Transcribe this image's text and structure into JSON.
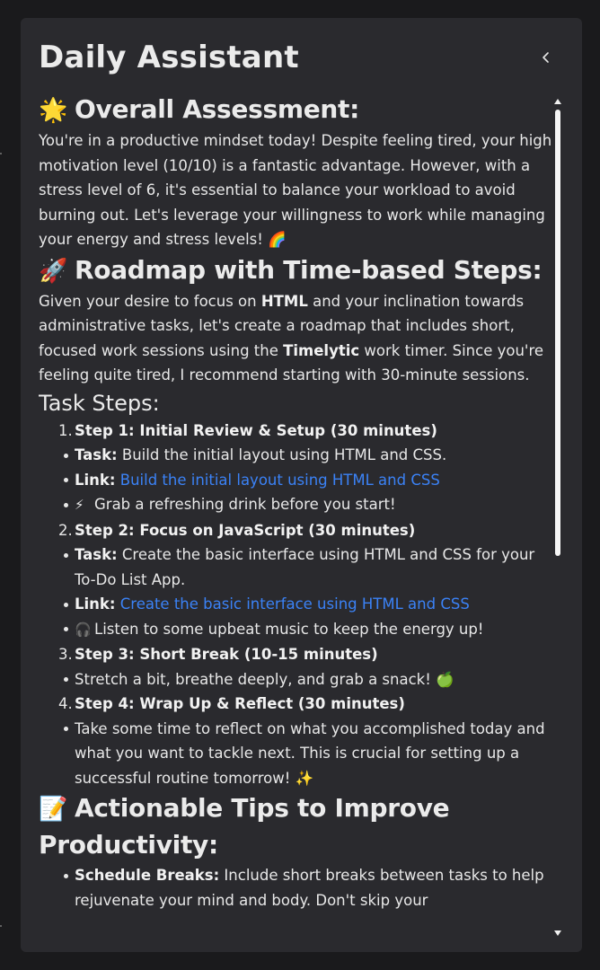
{
  "panel": {
    "title": "Daily Assistant",
    "collapse_icon": "chevron-left-icon"
  },
  "assessment": {
    "emoji": "🌟",
    "heading": "Overall Assessment:",
    "text": "You're in a productive mindset today! Despite feeling tired, your high motivation level (10/10) is a fantastic advantage. However, with a stress level of 6, it's essential to balance your workload to avoid burning out. Let's leverage your willingness to work while managing your energy and stress levels! 🌈"
  },
  "roadmap": {
    "emoji": "🚀",
    "heading": "Roadmap with Time-based Steps:",
    "intro_1": "Given your desire to focus on ",
    "intro_bold_1": "HTML",
    "intro_2": " and your inclination towards administrative tasks, let's create a roadmap that includes short, focused work sessions using the ",
    "intro_bold_2": "Timelytic",
    "intro_3": " work timer. Since you're feeling quite tired, I recommend starting with 30-minute sessions."
  },
  "task_steps": {
    "heading": "Task Steps:",
    "steps": [
      {
        "number": "1.",
        "title": "Step 1: Initial Review & Setup (30 minutes)",
        "task_label": "Task:",
        "task_text": " Build the initial layout using HTML and CSS.",
        "link_label": "Link:",
        "link_text": "Build the initial layout using HTML and CSS",
        "tip_icon": "⚡",
        "tip_text": "Grab a refreshing drink before you start!"
      },
      {
        "number": "2.",
        "title": "Step 2: Focus on JavaScript (30 minutes)",
        "task_label": "Task:",
        "task_text": " Create the basic interface using HTML and CSS for your To-Do List App.",
        "link_label": "Link:",
        "link_text": "Create the basic interface using HTML and CSS",
        "tip_icon": "🎧",
        "tip_text": "Listen to some upbeat music to keep the energy up!"
      },
      {
        "number": "3.",
        "title": "Step 3: Short Break (10-15 minutes)",
        "note": "Stretch a bit, breathe deeply, and grab a snack! 🍏"
      },
      {
        "number": "4.",
        "title": "Step 4: Wrap Up & Reflect (30 minutes)",
        "note": "Take some time to reflect on what you accomplished today and what you want to tackle next. This is crucial for setting up a successful routine tomorrow! ✨"
      }
    ]
  },
  "tips": {
    "emoji": "📝",
    "heading": "Actionable Tips to Improve Productivity:",
    "items": [
      {
        "label": "Schedule Breaks:",
        "text": " Include short breaks between tasks to help rejuvenate your mind and body. Don't skip your"
      }
    ]
  },
  "colors": {
    "page_background": "#1a1a1c",
    "panel_background": "#2a2a2e",
    "text": "#ebebeb",
    "link": "#3b82f6",
    "scroll_thumb": "#f5f5f5"
  }
}
